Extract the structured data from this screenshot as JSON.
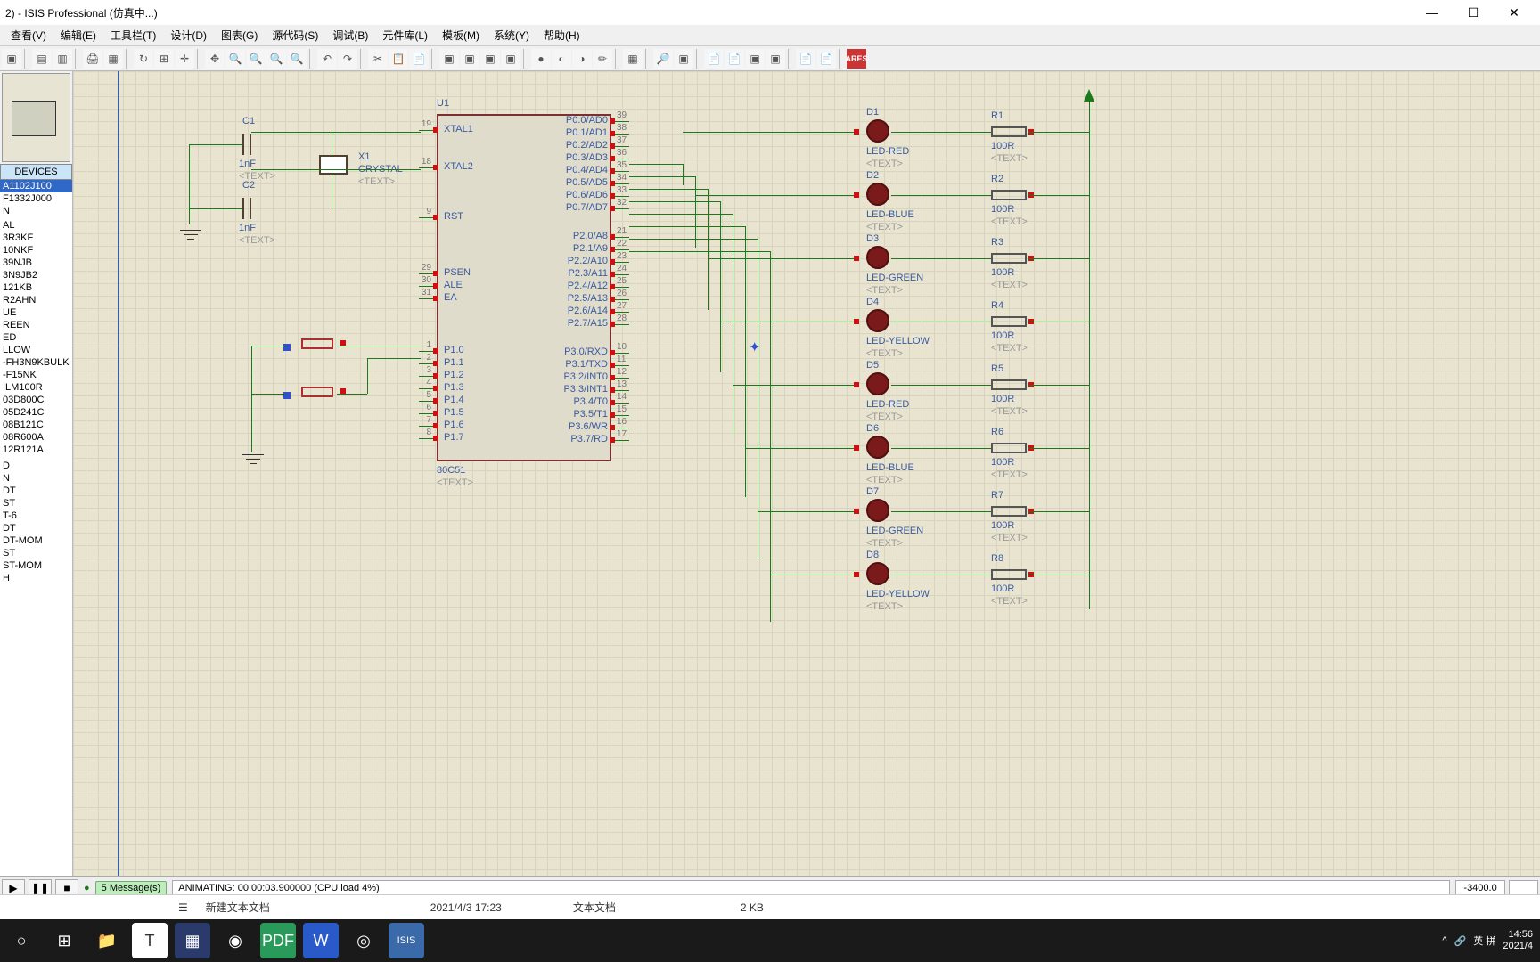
{
  "window": {
    "title": "2)  - ISIS Professional (仿真中...)",
    "min": "—",
    "max": "☐",
    "close": "✕"
  },
  "menu": {
    "items": [
      "查看(V)",
      "编辑(E)",
      "工具栏(T)",
      "设计(D)",
      "图表(G)",
      "源代码(S)",
      "调试(B)",
      "元件库(L)",
      "模板(M)",
      "系统(Y)",
      "帮助(H)"
    ]
  },
  "sidebar": {
    "devices_header": "DEVICES",
    "items": [
      "A1102J100",
      "F1332J000",
      "N",
      "",
      "AL",
      "3R3KF",
      "10NKF",
      "39NJB",
      "3N9JB2",
      "121KB",
      "R2AHN",
      "UE",
      "REEN",
      "ED",
      "LLOW",
      "-FH3N9KBULK",
      "-F15NK",
      "ILM100R",
      "03D800C",
      "05D241C",
      "08B121C",
      "08R600A",
      "12R121A",
      "",
      "",
      "D",
      "N",
      "DT",
      "ST",
      "T-6",
      "DT",
      "DT-MOM",
      "ST",
      "ST-MOM",
      "H"
    ]
  },
  "chip": {
    "ref": "U1",
    "name": "80C51",
    "text": "<TEXT>",
    "left_pins": [
      {
        "num": "19",
        "name": "XTAL1"
      },
      {
        "num": "18",
        "name": "XTAL2"
      },
      {
        "num": "9",
        "name": "RST"
      },
      {
        "num": "29",
        "name": "PSEN"
      },
      {
        "num": "30",
        "name": "ALE"
      },
      {
        "num": "31",
        "name": "EA"
      },
      {
        "num": "1",
        "name": "P1.0"
      },
      {
        "num": "2",
        "name": "P1.1"
      },
      {
        "num": "3",
        "name": "P1.2"
      },
      {
        "num": "4",
        "name": "P1.3"
      },
      {
        "num": "5",
        "name": "P1.4"
      },
      {
        "num": "6",
        "name": "P1.5"
      },
      {
        "num": "7",
        "name": "P1.6"
      },
      {
        "num": "8",
        "name": "P1.7"
      }
    ],
    "right_pins": [
      {
        "num": "39",
        "name": "P0.0/AD0"
      },
      {
        "num": "38",
        "name": "P0.1/AD1"
      },
      {
        "num": "37",
        "name": "P0.2/AD2"
      },
      {
        "num": "36",
        "name": "P0.3/AD3"
      },
      {
        "num": "35",
        "name": "P0.4/AD4"
      },
      {
        "num": "34",
        "name": "P0.5/AD5"
      },
      {
        "num": "33",
        "name": "P0.6/AD6"
      },
      {
        "num": "32",
        "name": "P0.7/AD7"
      },
      {
        "num": "21",
        "name": "P2.0/A8"
      },
      {
        "num": "22",
        "name": "P2.1/A9"
      },
      {
        "num": "23",
        "name": "P2.2/A10"
      },
      {
        "num": "24",
        "name": "P2.3/A11"
      },
      {
        "num": "25",
        "name": "P2.4/A12"
      },
      {
        "num": "26",
        "name": "P2.5/A13"
      },
      {
        "num": "27",
        "name": "P2.6/A14"
      },
      {
        "num": "28",
        "name": "P2.7/A15"
      },
      {
        "num": "10",
        "name": "P3.0/RXD"
      },
      {
        "num": "11",
        "name": "P3.1/TXD"
      },
      {
        "num": "12",
        "name": "P3.2/INT0"
      },
      {
        "num": "13",
        "name": "P3.3/INT1"
      },
      {
        "num": "14",
        "name": "P3.4/T0"
      },
      {
        "num": "15",
        "name": "P3.5/T1"
      },
      {
        "num": "16",
        "name": "P3.6/WR"
      },
      {
        "num": "17",
        "name": "P3.7/RD"
      }
    ]
  },
  "caps": [
    {
      "ref": "C1",
      "val": "1nF",
      "text": "<TEXT>"
    },
    {
      "ref": "C2",
      "val": "1nF",
      "text": "<TEXT>"
    }
  ],
  "crystal": {
    "ref": "X1",
    "name": "CRYSTAL",
    "text": "<TEXT>"
  },
  "leds": [
    {
      "ref": "D1",
      "name": "LED-RED",
      "text": "<TEXT>"
    },
    {
      "ref": "D2",
      "name": "LED-BLUE",
      "text": "<TEXT>"
    },
    {
      "ref": "D3",
      "name": "LED-GREEN",
      "text": "<TEXT>"
    },
    {
      "ref": "D4",
      "name": "LED-YELLOW",
      "text": "<TEXT>"
    },
    {
      "ref": "D5",
      "name": "LED-RED",
      "text": "<TEXT>"
    },
    {
      "ref": "D6",
      "name": "LED-BLUE",
      "text": "<TEXT>"
    },
    {
      "ref": "D7",
      "name": "LED-GREEN",
      "text": "<TEXT>"
    },
    {
      "ref": "D8",
      "name": "LED-YELLOW",
      "text": "<TEXT>"
    }
  ],
  "resistors": [
    {
      "ref": "R1",
      "val": "100R",
      "text": "<TEXT>"
    },
    {
      "ref": "R2",
      "val": "100R",
      "text": "<TEXT>"
    },
    {
      "ref": "R3",
      "val": "100R",
      "text": "<TEXT>"
    },
    {
      "ref": "R4",
      "val": "100R",
      "text": "<TEXT>"
    },
    {
      "ref": "R5",
      "val": "100R",
      "text": "<TEXT>"
    },
    {
      "ref": "R6",
      "val": "100R",
      "text": "<TEXT>"
    },
    {
      "ref": "R7",
      "val": "100R",
      "text": "<TEXT>"
    },
    {
      "ref": "R8",
      "val": "100R",
      "text": "<TEXT>"
    }
  ],
  "sim": {
    "play": "▶",
    "pause": "❚❚",
    "stop": "■",
    "msgs": "5 Message(s)",
    "status": "ANIMATING: 00:00:03.900000 (CPU load 4%)",
    "coord": "-3400.0"
  },
  "filebar": {
    "icon": "☰",
    "name": "新建文本文档",
    "date": "2021/4/3  17:23",
    "type": "文本文档",
    "size": "2 KB"
  },
  "taskbar": {
    "time": "14:56",
    "date": "2021/4",
    "ime": "英  拼"
  }
}
